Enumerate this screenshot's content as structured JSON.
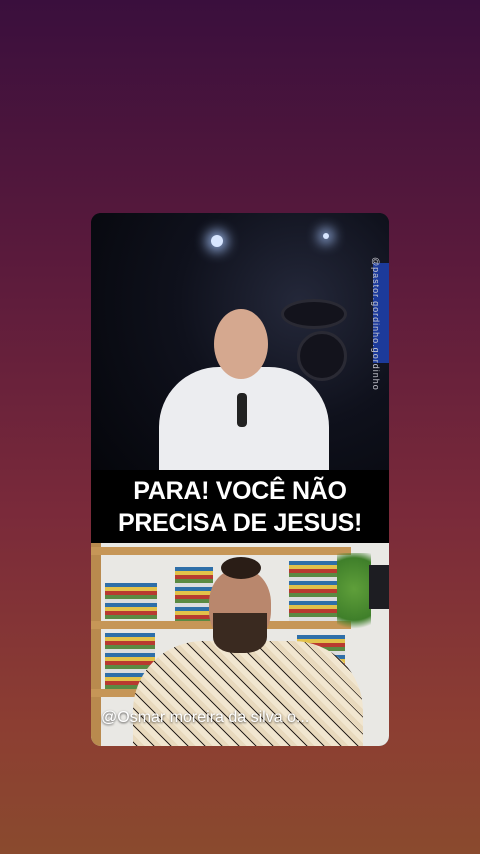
{
  "video_card": {
    "caption_line1": "PARA! VOCÊ NÃO",
    "caption_line2": "PRECISA DE JESUS!",
    "watermark_text": "@pastor.gordinho.gordinho",
    "creator_handle": "@Osmar moreira da silva o..."
  },
  "colors": {
    "background_top": "#3a0f3d",
    "background_bottom": "#8a4a2e",
    "caption_bg": "#000000",
    "caption_text": "#ffffff"
  }
}
